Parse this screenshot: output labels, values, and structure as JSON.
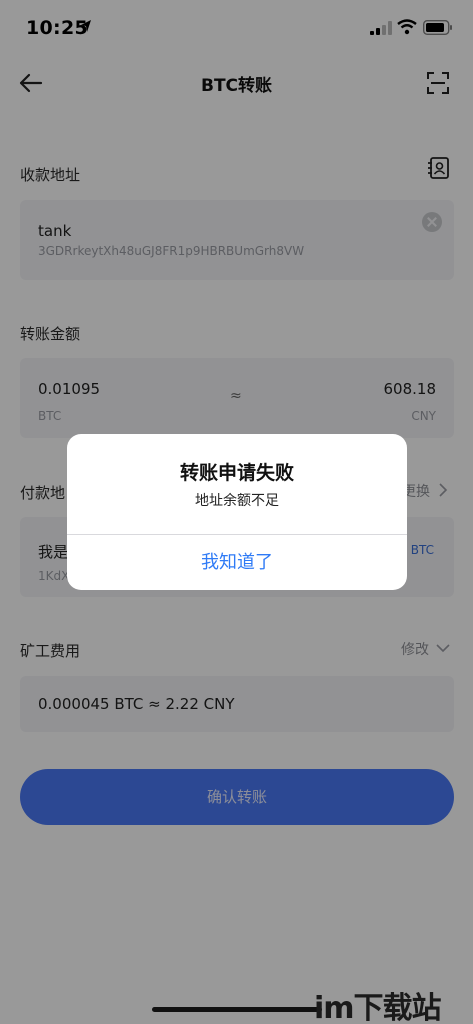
{
  "status_bar": {
    "time": "10:25"
  },
  "nav": {
    "title": "BTC转账"
  },
  "recipient": {
    "label": "收款地址",
    "name": "tank",
    "address": "3GDRrkeytXh48uGJ8FR1p9HBRBUmGrh8VW"
  },
  "amount": {
    "label": "转账金额",
    "btc_value": "0.01095",
    "btc_unit": "BTC",
    "approx": "≈",
    "cny_value": "608.18",
    "cny_unit": "CNY"
  },
  "payer": {
    "label": "付款地",
    "switch_label": "更换",
    "name": "我是",
    "address": "1KdX",
    "balance_unit": "BTC"
  },
  "fee": {
    "label": "矿工费用",
    "modify_label": "修改",
    "value": "0.000045 BTC ≈ 2.22 CNY"
  },
  "confirm_button": "确认转账",
  "alert": {
    "title": "转账申请失败",
    "message": "地址余额不足",
    "button": "我知道了"
  },
  "watermark": "im下载站",
  "colors": {
    "primary": "#4a78f5",
    "alert_link": "#2f7bf6",
    "overlay": "rgba(0,0,0,0.40)"
  }
}
